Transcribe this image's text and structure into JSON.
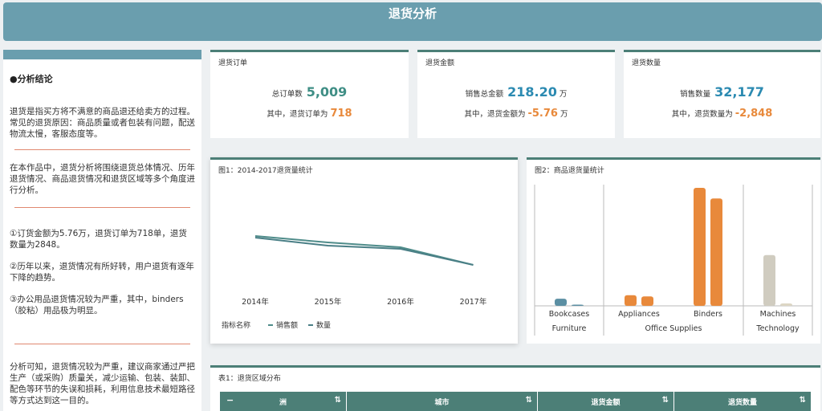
{
  "header": {
    "title": "退货分析"
  },
  "sidebar": {
    "strip_text": "",
    "section_title": "●分析结论",
    "para1": "退货是指买方将不满意的商品退还给卖方的过程。常见的退货原因：商品质量或者包装有问题，配送物流太慢，客服态度等。",
    "para2": "在本作品中，退货分析将围绕退货总体情况、历年退货情况、商品退货情况和退货区域等多个角度进行分析。",
    "point1": "①订货金额为5.76万，退货订单为718单，退货数量为2848。",
    "point2": "②历年以来，退货情况有所好转，用户退货有逐年下降的趋势。",
    "point3": "③办公用品退货情况较为严重，其中，binders（胶粘）用品极为明显。",
    "para3": "分析可知，退货情况较为严重，建议商家通过严把生产（或采购）质量关，减少运输、包装、装卸、配色等环节的失误和损耗，利用信息技术最短路径等方式达到这一目的。"
  },
  "kpis": {
    "orders": {
      "title": "退货订单",
      "label1": "总订单数",
      "value1": "5,009",
      "label2": "其中，退货订单为",
      "value2": "718"
    },
    "amount": {
      "title": "退货金额",
      "label1": "销售总金额",
      "value1": "218.20",
      "unit1": "万",
      "label2": "其中，退货金额为",
      "value2": "-5.76",
      "unit2": "万"
    },
    "qty": {
      "title": "退货数量",
      "label1": "销售数量",
      "value1": "32,177",
      "label2": "其中，退货数量为",
      "value2": "-2,848"
    }
  },
  "chart_data": [
    {
      "type": "line",
      "title": "图1：2014-2017退货量统计",
      "categories": [
        "2014年",
        "2015年",
        "2016年",
        "2017年"
      ],
      "legend_title": "指标名称",
      "legend_placement": "bottom-left",
      "series": [
        {
          "name": "销售额",
          "color": "#4f8c8a",
          "values": [
            0.86,
            0.78,
            0.72,
            0.5
          ]
        },
        {
          "name": "数量",
          "color": "#4a7f86",
          "values": [
            0.84,
            0.74,
            0.7,
            0.5
          ]
        }
      ]
    },
    {
      "type": "bar",
      "title": "图2：商品退货量统计",
      "groups": [
        {
          "name": "Furniture",
          "categories": [
            "Bookcases"
          ]
        },
        {
          "name": "Office Supplies",
          "categories": [
            "Appliances",
            "Binders"
          ]
        },
        {
          "name": "Technology",
          "categories": [
            "Machines"
          ]
        }
      ],
      "categories": [
        "Bookcases",
        "Appliances",
        "Binders",
        "Machines"
      ],
      "series": [
        {
          "values": [
            6,
            9,
            100,
            43
          ]
        },
        {
          "values": [
            1,
            8,
            91,
            2
          ]
        }
      ],
      "bar_colors": [
        "#5b8fa3",
        "#e8893b",
        "#e8893b",
        "#d0ccc0"
      ]
    }
  ],
  "table": {
    "title": "表1：退货区域分布",
    "columns": [
      "洲",
      "城市",
      "退货金额",
      "退货数量"
    ],
    "collapse_glyph": "−"
  }
}
